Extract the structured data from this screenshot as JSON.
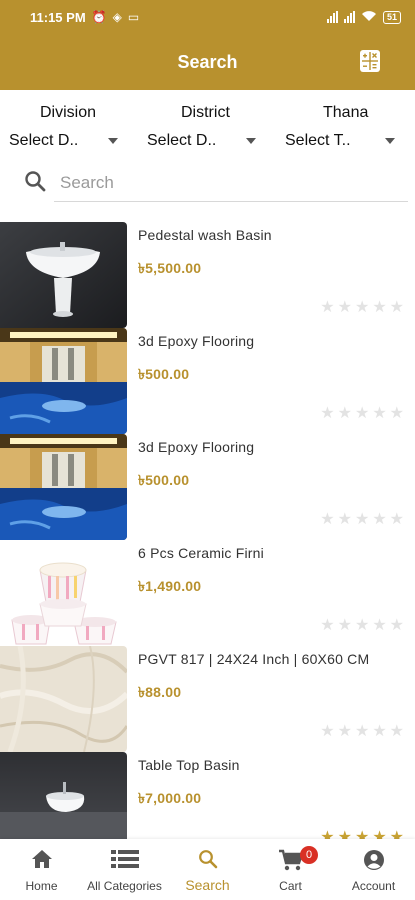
{
  "statusbar": {
    "time": "11:15 PM",
    "battery": "51"
  },
  "appbar": {
    "title": "Search"
  },
  "filters": [
    {
      "label": "Division",
      "selected": "Select D.."
    },
    {
      "label": "District",
      "selected": "Select D.."
    },
    {
      "label": "Thana",
      "selected": "Select T.."
    }
  ],
  "search": {
    "placeholder": "Search",
    "value": ""
  },
  "products": [
    {
      "name": "Pedestal wash Basin",
      "price": "৳5,500.00",
      "rating": 0
    },
    {
      "name": "3d Epoxy Flooring",
      "price": "৳500.00",
      "rating": 0
    },
    {
      "name": "3d Epoxy Flooring",
      "price": "৳500.00",
      "rating": 0
    },
    {
      "name": "6 Pcs Ceramic Firni",
      "price": "৳1,490.00",
      "rating": 0
    },
    {
      "name": "PGVT 817 | 24X24 Inch | 60X60 CM",
      "price": "৳88.00",
      "rating": 0
    },
    {
      "name": "Table Top Basin",
      "price": "৳7,000.00",
      "rating": 5
    }
  ],
  "bottomnav": {
    "items": [
      {
        "label": "Home",
        "icon": "home-icon"
      },
      {
        "label": "All Categories",
        "icon": "list-icon"
      },
      {
        "label": "Search",
        "icon": "search-icon"
      },
      {
        "label": "Cart",
        "icon": "cart-icon"
      },
      {
        "label": "Account",
        "icon": "account-icon"
      }
    ],
    "cart_count": "0",
    "active": "Search"
  },
  "colors": {
    "brand": "#b8912e",
    "star_on": "#c8a233",
    "star_off": "#e3e3e3",
    "badge": "#d93025"
  }
}
